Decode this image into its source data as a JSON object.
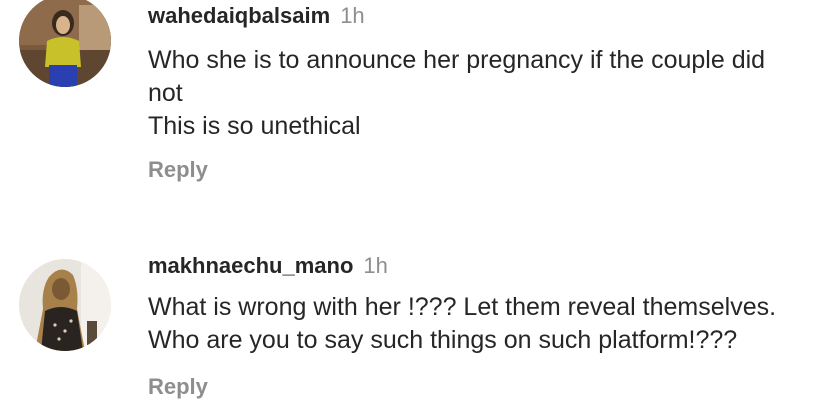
{
  "comments": [
    {
      "username": "wahedaiqbalsaim",
      "time": "1h",
      "lines": [
        "Who she is to announce her pregnancy if the couple did",
        "not",
        "This is so unethical"
      ],
      "reply_label": "Reply"
    },
    {
      "username": "makhnaechu_mano",
      "time": "1h",
      "lines": [
        "What is wrong with her !??? Let them reveal themselves.",
        "Who are you to say such things on such platform!???"
      ],
      "reply_label": "Reply"
    }
  ]
}
